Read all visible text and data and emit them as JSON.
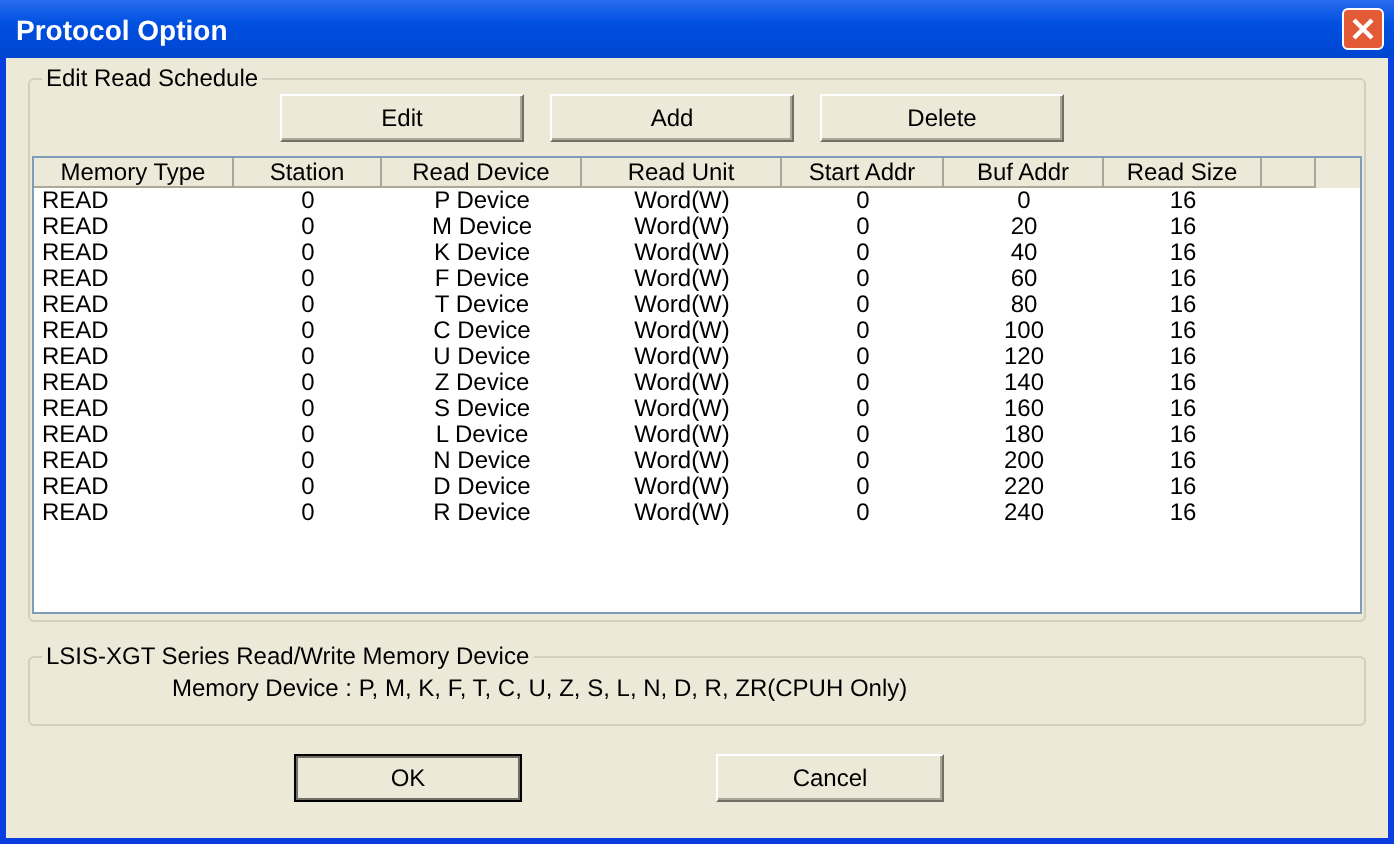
{
  "window": {
    "title": "Protocol Option"
  },
  "schedule": {
    "title": "Edit Read Schedule",
    "buttons": [
      "Edit",
      "Add",
      "Delete"
    ],
    "columns": [
      "Memory Type",
      "Station",
      "Read Device",
      "Read Unit",
      "Start Addr",
      "Buf Addr",
      "Read Size"
    ],
    "rows": [
      [
        "READ",
        "0",
        "P Device",
        "Word(W)",
        "0",
        "0",
        "16"
      ],
      [
        "READ",
        "0",
        "M Device",
        "Word(W)",
        "0",
        "20",
        "16"
      ],
      [
        "READ",
        "0",
        "K Device",
        "Word(W)",
        "0",
        "40",
        "16"
      ],
      [
        "READ",
        "0",
        "F Device",
        "Word(W)",
        "0",
        "60",
        "16"
      ],
      [
        "READ",
        "0",
        "T Device",
        "Word(W)",
        "0",
        "80",
        "16"
      ],
      [
        "READ",
        "0",
        "C Device",
        "Word(W)",
        "0",
        "100",
        "16"
      ],
      [
        "READ",
        "0",
        "U Device",
        "Word(W)",
        "0",
        "120",
        "16"
      ],
      [
        "READ",
        "0",
        "Z Device",
        "Word(W)",
        "0",
        "140",
        "16"
      ],
      [
        "READ",
        "0",
        "S Device",
        "Word(W)",
        "0",
        "160",
        "16"
      ],
      [
        "READ",
        "0",
        "L Device",
        "Word(W)",
        "0",
        "180",
        "16"
      ],
      [
        "READ",
        "0",
        "N Device",
        "Word(W)",
        "0",
        "200",
        "16"
      ],
      [
        "READ",
        "0",
        "D Device",
        "Word(W)",
        "0",
        "220",
        "16"
      ],
      [
        "READ",
        "0",
        "R Device",
        "Word(W)",
        "0",
        "240",
        "16"
      ]
    ]
  },
  "info": {
    "title": "LSIS-XGT Series Read/Write Memory Device",
    "text": "Memory Device : P,  M,  K,  F,  T,  C,  U,  Z,  S,  L,  N,  D,  R,  ZR(CPUH Only)"
  },
  "buttons": [
    {
      "label": "OK",
      "default": true
    },
    {
      "label": "Cancel",
      "default": false
    }
  ]
}
